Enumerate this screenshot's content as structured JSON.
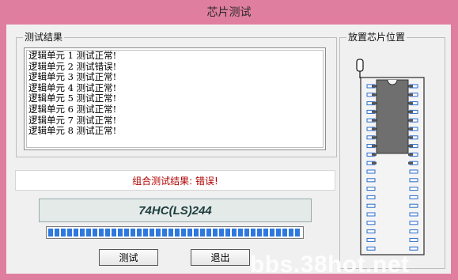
{
  "window": {
    "title": "芯片测试"
  },
  "results_group": {
    "label": "测试结果",
    "lines": [
      "逻辑单元 1 测试正常!",
      "逻辑单元 2 测试错误!",
      "逻辑单元 3 测试正常!",
      "逻辑单元 4 测试正常!",
      "逻辑单元 5 测试正常!",
      "逻辑单元 6 测试正常!",
      "逻辑单元 7 测试正常!",
      "逻辑单元 8 测试正常!"
    ]
  },
  "summary": {
    "text": "组合测试结果: 错误!",
    "color": "#B00000"
  },
  "chip": {
    "name": "74HC(LS)244"
  },
  "progress": {
    "value": 1.0,
    "color": "#2E78DE"
  },
  "buttons": {
    "test_label": "测试",
    "exit_label": "退出"
  },
  "socket_group": {
    "label": "放置芯片位置",
    "pins_per_side": 20,
    "chip_pins": 20
  },
  "watermark": {
    "text": "bbs.38hot.net"
  },
  "colors": {
    "frame": "#E07EA0",
    "client": "#F0F0F0",
    "chip_body": "#6F6F6F",
    "socket_slot": "#2A6BCF"
  }
}
